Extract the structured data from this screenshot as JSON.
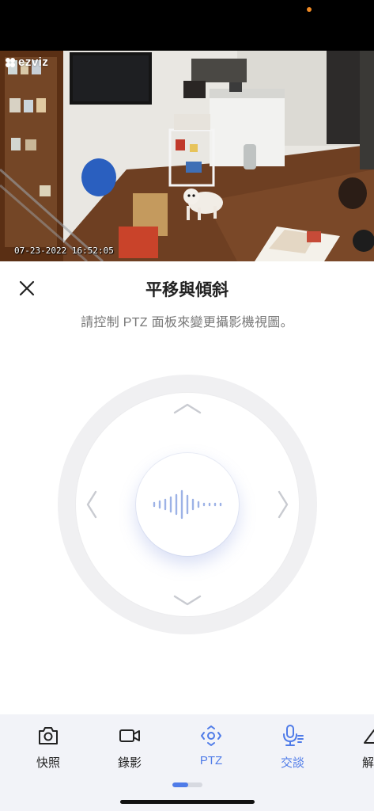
{
  "camera": {
    "brand": "ezviz",
    "timestamp": "07-23-2022  16:52:05"
  },
  "panel": {
    "title": "平移與傾斜",
    "subtitle": "請控制 PTZ 面板來變更攝影機視圖。",
    "close_icon": "close-icon"
  },
  "dpad": {
    "up_icon": "chevron-up-icon",
    "down_icon": "chevron-down-icon",
    "left_icon": "chevron-left-icon",
    "right_icon": "chevron-right-icon",
    "center_icon": "voice-wave-icon"
  },
  "toolbar": {
    "items": [
      {
        "label": "快照",
        "icon": "camera-icon",
        "active": false
      },
      {
        "label": "錄影",
        "icon": "video-record-icon",
        "active": false
      },
      {
        "label": "PTZ",
        "icon": "ptz-icon",
        "active": true
      },
      {
        "label": "交談",
        "icon": "microphone-icon",
        "active": true
      },
      {
        "label": "解晰",
        "icon": "resolution-icon",
        "active": false
      }
    ]
  },
  "colors": {
    "accent": "#4f7be8",
    "status_dot": "#f08a24",
    "text_primary": "#222222",
    "text_secondary": "#777777"
  }
}
